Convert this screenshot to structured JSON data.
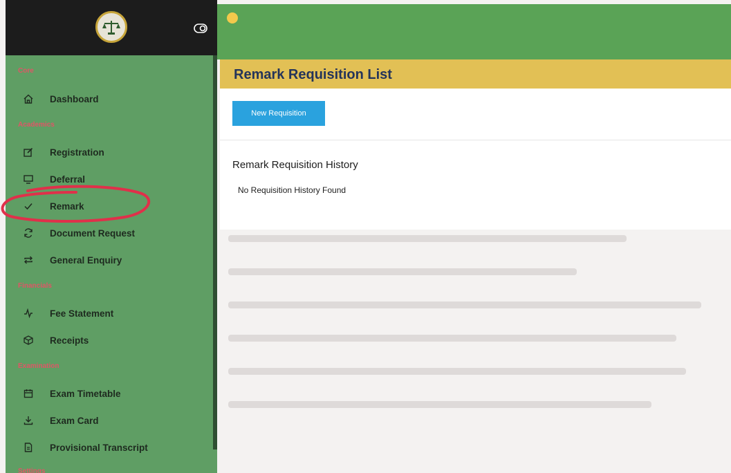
{
  "sidebar": {
    "sections": [
      {
        "title": "Core"
      },
      {
        "title": "Academics"
      },
      {
        "title": "Financials"
      },
      {
        "title": "Examination"
      },
      {
        "title": "Settings"
      }
    ],
    "items": [
      {
        "label": "Dashboard",
        "icon": "home-icon"
      },
      {
        "label": "Registration",
        "icon": "edit-icon"
      },
      {
        "label": "Deferral",
        "icon": "monitor-icon"
      },
      {
        "label": "Remark",
        "icon": "check-icon"
      },
      {
        "label": "Document Request",
        "icon": "refresh-icon"
      },
      {
        "label": "General Enquiry",
        "icon": "repeat-icon"
      },
      {
        "label": "Fee Statement",
        "icon": "activity-icon"
      },
      {
        "label": "Receipts",
        "icon": "box-icon"
      },
      {
        "label": "Exam Timetable",
        "icon": "calendar-icon"
      },
      {
        "label": "Exam Card",
        "icon": "download-icon"
      },
      {
        "label": "Provisional Transcript",
        "icon": "document-icon"
      }
    ]
  },
  "header": {
    "title": "Remark Requisition List"
  },
  "main": {
    "new_button_label": "New Requisition",
    "history_title": "Remark Requisition History",
    "history_empty": "No Requisition History Found"
  },
  "colors": {
    "sidebar": "#5f9e64",
    "topbar": "#5aa356",
    "header": "#e2c055",
    "button": "#2aa2de",
    "annotation": "#e0304a"
  }
}
